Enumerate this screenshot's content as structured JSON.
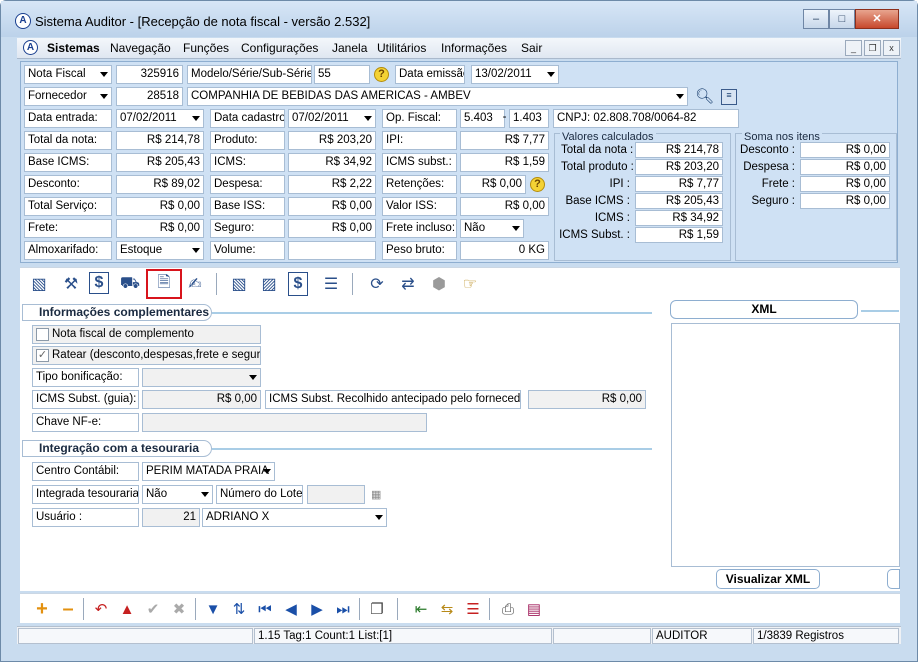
{
  "window": {
    "title": "Sistema Auditor - [Recepção de nota fiscal - versão 2.532]",
    "app_icon": "A"
  },
  "menu": {
    "items": [
      "Sistemas",
      "Navegação",
      "Funções",
      "Configurações",
      "Janela",
      "Utilitários",
      "Informações",
      "Sair"
    ]
  },
  "header": {
    "doc_type": "Nota Fiscal",
    "doc_number": "325916",
    "modelo_label": "Modelo/Série/Sub-Série:",
    "modelo_value": "55",
    "data_emissao_label": "Data emissão:",
    "data_emissao": "13/02/2011",
    "fornecedor_label": "Fornecedor",
    "fornecedor_code": "28518",
    "fornecedor_name": "COMPANHIA DE BEBIDAS DAS AMERICAS - AMBEV",
    "data_entrada_label": "Data entrada:",
    "data_entrada": "07/02/2011",
    "data_cadastro_label": "Data cadastro:",
    "data_cadastro": "07/02/2011",
    "op_fiscal_label": "Op. Fiscal:",
    "op_fiscal_a": "5.403",
    "op_fiscal_dash": "-",
    "op_fiscal_b": "1.403",
    "cnpj": "CNPJ: 02.808.708/0064-82",
    "total_nota_label": "Total da nota:",
    "total_nota": "R$ 214,78",
    "produto_label": "Produto:",
    "produto": "R$ 203,20",
    "ipi_label": "IPI:",
    "ipi": "R$ 7,77",
    "base_icms_label": "Base ICMS:",
    "base_icms": "R$ 205,43",
    "icms_label": "ICMS:",
    "icms": "R$ 34,92",
    "icms_subst_label": "ICMS subst.:",
    "icms_subst": "R$ 1,59",
    "desconto_label": "Desconto:",
    "desconto": "R$ 89,02",
    "despesa_label": "Despesa:",
    "despesa": "R$ 2,22",
    "retencoes_label": "Retenções:",
    "retencoes": "R$ 0,00",
    "total_servico_label": "Total Serviço:",
    "total_servico": "R$ 0,00",
    "base_iss_label": "Base ISS:",
    "base_iss": "R$ 0,00",
    "valor_iss_label": "Valor ISS:",
    "valor_iss": "R$ 0,00",
    "frete_label": "Frete:",
    "frete": "R$ 0,00",
    "seguro_label": "Seguro:",
    "seguro": "R$ 0,00",
    "frete_incluso_label": "Frete incluso:",
    "frete_incluso": "Não",
    "almoxarifado_label": "Almoxarifado:",
    "almoxarifado": "Estoque",
    "volume_label": "Volume:",
    "volume": "",
    "peso_bruto_label": "Peso bruto:",
    "peso_bruto": "0 KG"
  },
  "valores_calculados": {
    "title": "Valores calculados",
    "rows": [
      {
        "label": "Total da nota :",
        "value": "R$ 214,78"
      },
      {
        "label": "Total produto :",
        "value": "R$ 203,20"
      },
      {
        "label": "IPI :",
        "value": "R$ 7,77"
      },
      {
        "label": "Base ICMS :",
        "value": "R$ 205,43"
      },
      {
        "label": "ICMS :",
        "value": "R$ 34,92"
      },
      {
        "label": "ICMS Subst. :",
        "value": "R$ 1,59"
      }
    ]
  },
  "soma_itens": {
    "title": "Soma nos itens",
    "rows": [
      {
        "label": "Desconto :",
        "value": "R$ 0,00"
      },
      {
        "label": "Despesa :",
        "value": "R$ 0,00"
      },
      {
        "label": "Frete :",
        "value": "R$ 0,00"
      },
      {
        "label": "Seguro :",
        "value": "R$ 0,00"
      }
    ]
  },
  "info": {
    "section_title": "Informações complementares",
    "nf_complemento": "Nota fiscal de complemento",
    "ratear": "Ratear (desconto,despesas,frete e seguro)",
    "tipo_bonificacao_label": "Tipo bonificação:",
    "tipo_bonificacao": "",
    "icms_subst_guia_label": "ICMS Subst. (guia):",
    "icms_subst_guia": "R$ 0,00",
    "icms_antecipado_label": "ICMS Subst. Recolhido antecipado pelo fornecedor:",
    "icms_antecipado": "R$ 0,00",
    "chave_label": "Chave NF-e:",
    "chave": ""
  },
  "tesouraria": {
    "section_title": "Integração com a tesouraria",
    "centro_label": "Centro Contábil:",
    "centro": "PERIM MATADA PRAIA",
    "integrada_label": "Integrada tesouraria:",
    "integrada": "Não",
    "lote_label": "Número do Lote:",
    "lote": "",
    "usuario_label": "Usuário :",
    "usuario_code": "21",
    "usuario_name": "ADRIANO X"
  },
  "xml": {
    "tab_label": "XML",
    "button_label": "Visualizar XML"
  },
  "status": {
    "left": "",
    "middle": "1.15 Tag:1 Count:1 List:[1]",
    "extra": "",
    "user": "AUDITOR",
    "records": "1/3839 Registros"
  }
}
